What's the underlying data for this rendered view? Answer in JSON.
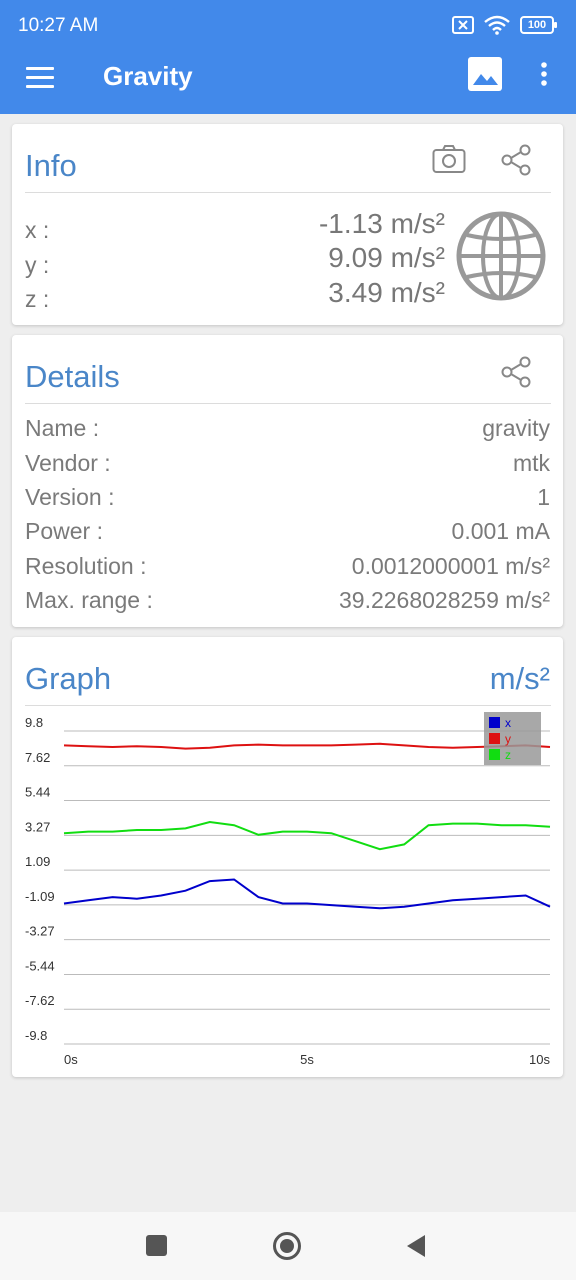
{
  "status": {
    "time": "10:27 AM",
    "battery": "100"
  },
  "appbar": {
    "title": "Gravity"
  },
  "info": {
    "title": "Info",
    "rows": [
      {
        "label": "x :",
        "value": "-1.13 m/s²"
      },
      {
        "label": "y :",
        "value": "9.09 m/s²"
      },
      {
        "label": "z :",
        "value": "3.49 m/s²"
      }
    ]
  },
  "details": {
    "title": "Details",
    "rows": [
      {
        "label": "Name :",
        "value": "gravity"
      },
      {
        "label": "Vendor :",
        "value": "mtk"
      },
      {
        "label": "Version :",
        "value": "1"
      },
      {
        "label": "Power :",
        "value": "0.001 mA"
      },
      {
        "label": "Resolution :",
        "value": "0.0012000001 m/s²"
      },
      {
        "label": "Max. range :",
        "value": "39.2268028259 m/s²"
      }
    ]
  },
  "graph": {
    "title": "Graph",
    "unit": "m/s²"
  },
  "colors": {
    "accent": "#4289ea",
    "title_blue": "#4a86c8",
    "x": "#0000cc",
    "y": "#dd1111",
    "z": "#11dd11"
  },
  "chart_data": {
    "type": "line",
    "xlabel": "",
    "ylabel": "",
    "x_ticks": [
      "0s",
      "5s",
      "10s"
    ],
    "y_ticks": [
      "9.8",
      "7.62",
      "5.44",
      "3.27",
      "1.09",
      "-1.09",
      "-3.27",
      "-5.44",
      "-7.62",
      "-9.8"
    ],
    "ylim": [
      -9.8,
      9.8
    ],
    "xlim": [
      0,
      10
    ],
    "grid": true,
    "legend": "top-right",
    "x": [
      0,
      0.5,
      1,
      1.5,
      2,
      2.5,
      3,
      3.5,
      4,
      4.5,
      5,
      5.5,
      6,
      6.5,
      7,
      7.5,
      8,
      8.5,
      9,
      9.5,
      10
    ],
    "series": [
      {
        "name": "x",
        "color": "#0000cc",
        "values": [
          -1.0,
          -0.8,
          -0.6,
          -0.7,
          -0.5,
          -0.2,
          0.4,
          0.5,
          -0.6,
          -1.0,
          -1.0,
          -1.1,
          -1.2,
          -1.3,
          -1.2,
          -1.0,
          -0.8,
          -0.7,
          -0.6,
          -0.5,
          -1.2
        ]
      },
      {
        "name": "y",
        "color": "#dd1111",
        "values": [
          8.9,
          8.85,
          8.8,
          8.85,
          8.8,
          8.7,
          8.75,
          8.9,
          8.95,
          8.9,
          8.9,
          8.9,
          8.95,
          9.0,
          8.9,
          8.8,
          8.75,
          8.8,
          8.85,
          8.9,
          8.8
        ]
      },
      {
        "name": "z",
        "color": "#11dd11",
        "values": [
          3.4,
          3.5,
          3.5,
          3.6,
          3.6,
          3.7,
          4.1,
          3.9,
          3.3,
          3.5,
          3.5,
          3.4,
          2.9,
          2.4,
          2.7,
          3.9,
          4.0,
          4.0,
          3.9,
          3.9,
          3.8
        ]
      }
    ]
  }
}
